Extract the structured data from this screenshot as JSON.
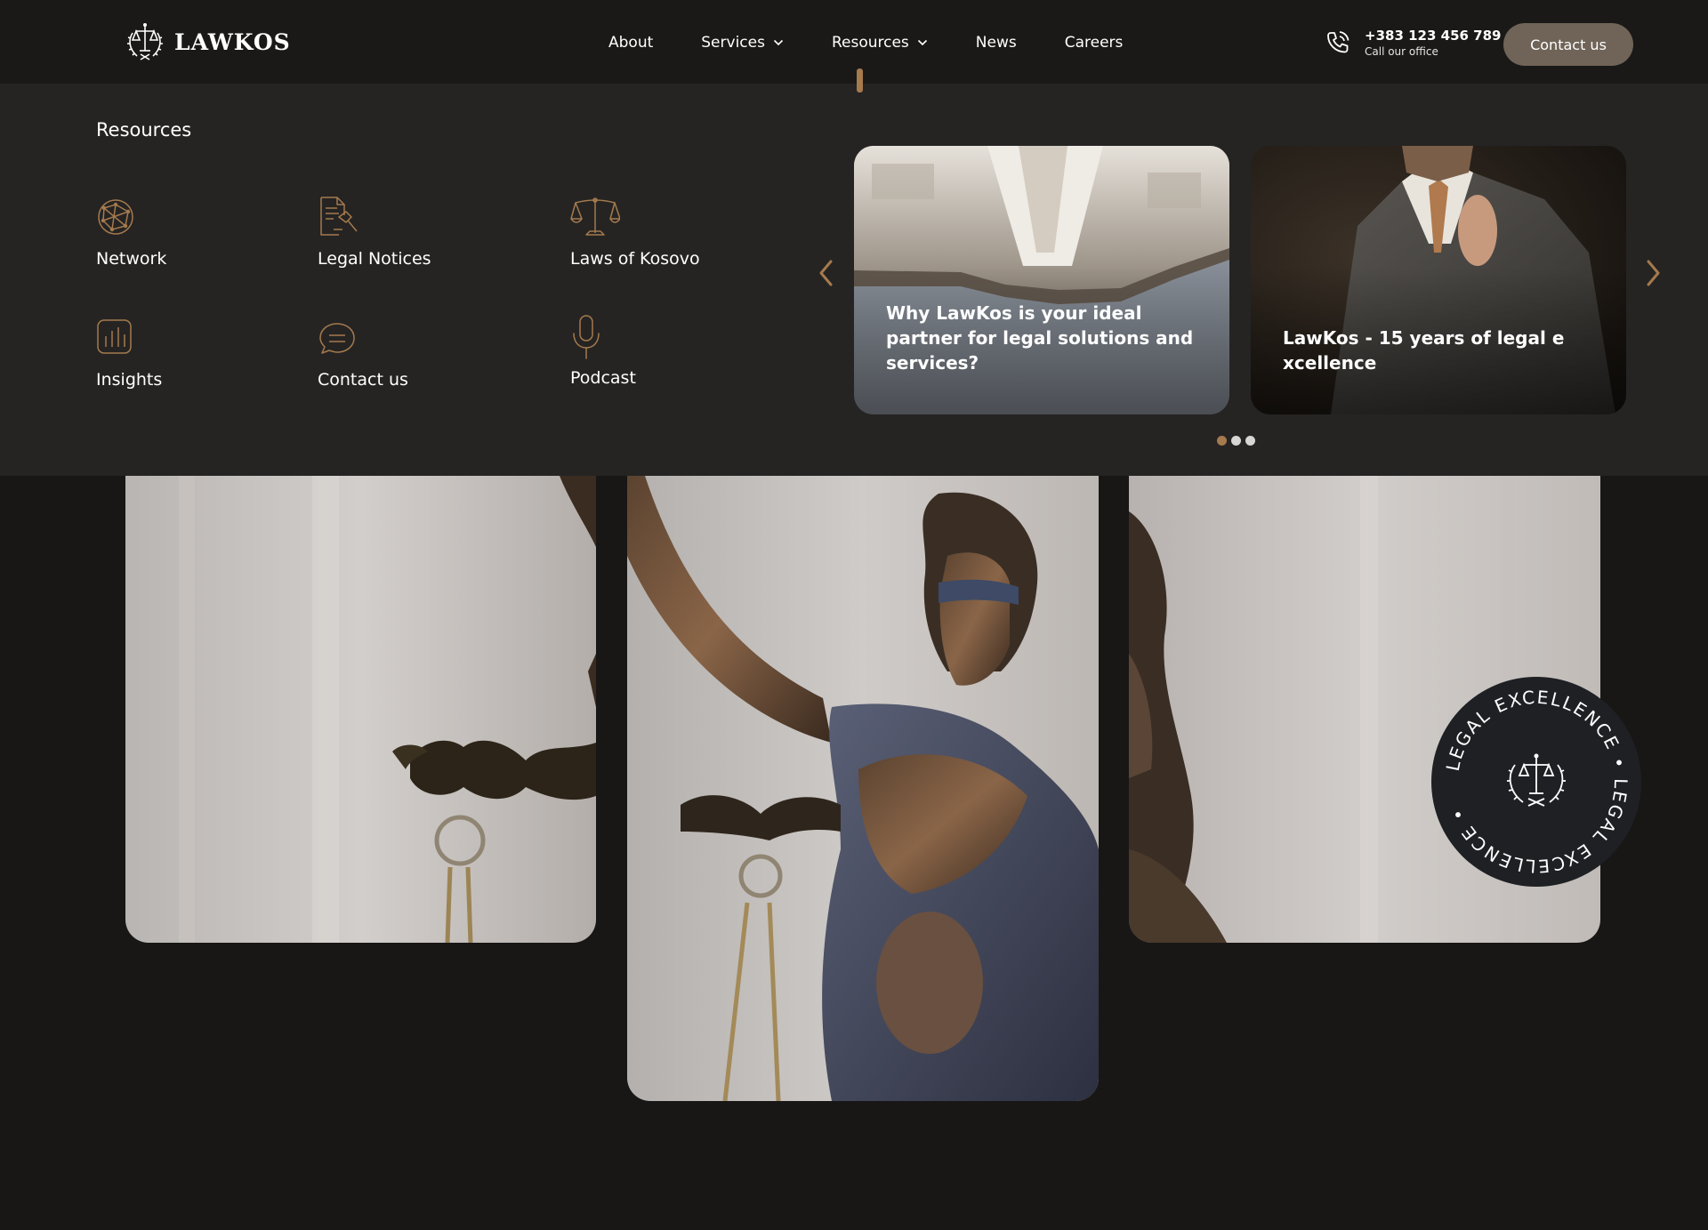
{
  "header": {
    "logo_text": "LAWKOS",
    "nav": [
      {
        "label": "About",
        "has_dropdown": false
      },
      {
        "label": "Services",
        "has_dropdown": true
      },
      {
        "label": "Resources",
        "has_dropdown": true,
        "active": true
      },
      {
        "label": "News",
        "has_dropdown": false
      },
      {
        "label": "Careers",
        "has_dropdown": false
      }
    ],
    "phone_number": "+383 123 456 789",
    "phone_sub": "Call our office",
    "contact_button": "Contact us"
  },
  "mega_menu": {
    "title": "Resources",
    "items": [
      {
        "label": "Network",
        "icon": "network-globe-icon"
      },
      {
        "label": "Legal Notices",
        "icon": "legal-document-icon"
      },
      {
        "label": "Laws of Kosovo",
        "icon": "scales-icon"
      },
      {
        "label": "Insights",
        "icon": "bar-chart-icon"
      },
      {
        "label": "Contact us",
        "icon": "chat-bubble-icon"
      },
      {
        "label": "Podcast",
        "icon": "microphone-icon"
      }
    ],
    "cards": [
      {
        "caption": "Why LawKos is your ideal partner for legal solutions and services?"
      },
      {
        "caption": "LawKos - 15 years of legal e xcellence"
      }
    ],
    "slider_dots": 3,
    "active_dot": 0
  },
  "badge": {
    "text": "LEGAL EXCELLENCE • LEGAL EXCELLENCE •"
  },
  "colors": {
    "accent": "#a57a4e",
    "background": "#181716",
    "menu_background": "#252423",
    "button": "#6f6457"
  }
}
